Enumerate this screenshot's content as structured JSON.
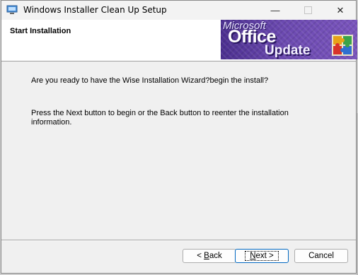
{
  "window": {
    "title": "Windows Installer Clean Up Setup",
    "accent": "#0067c0"
  },
  "titlebar_buttons": {
    "minimize_icon": "minimize-icon",
    "maximize_icon": "maximize-icon",
    "close_icon": "close-icon",
    "close_glyph": "✕",
    "minimize_glyph": "—"
  },
  "header": {
    "title": "Start Installation",
    "banner": {
      "line1": "Microsoft",
      "line2": "Office",
      "line3": "Update",
      "logo_icon": "office-puzzle-icon"
    }
  },
  "content": {
    "paragraph1": "Are you ready to have the Wise Installation Wizard?begin the install?",
    "paragraph2": "Press the Next button to begin or the Back button to reenter the installation information."
  },
  "buttons": {
    "back_prefix": "< ",
    "back_mnemonic": "B",
    "back_rest": "ack",
    "next_mnemonic": "N",
    "next_rest": "ext >",
    "cancel": "Cancel"
  }
}
